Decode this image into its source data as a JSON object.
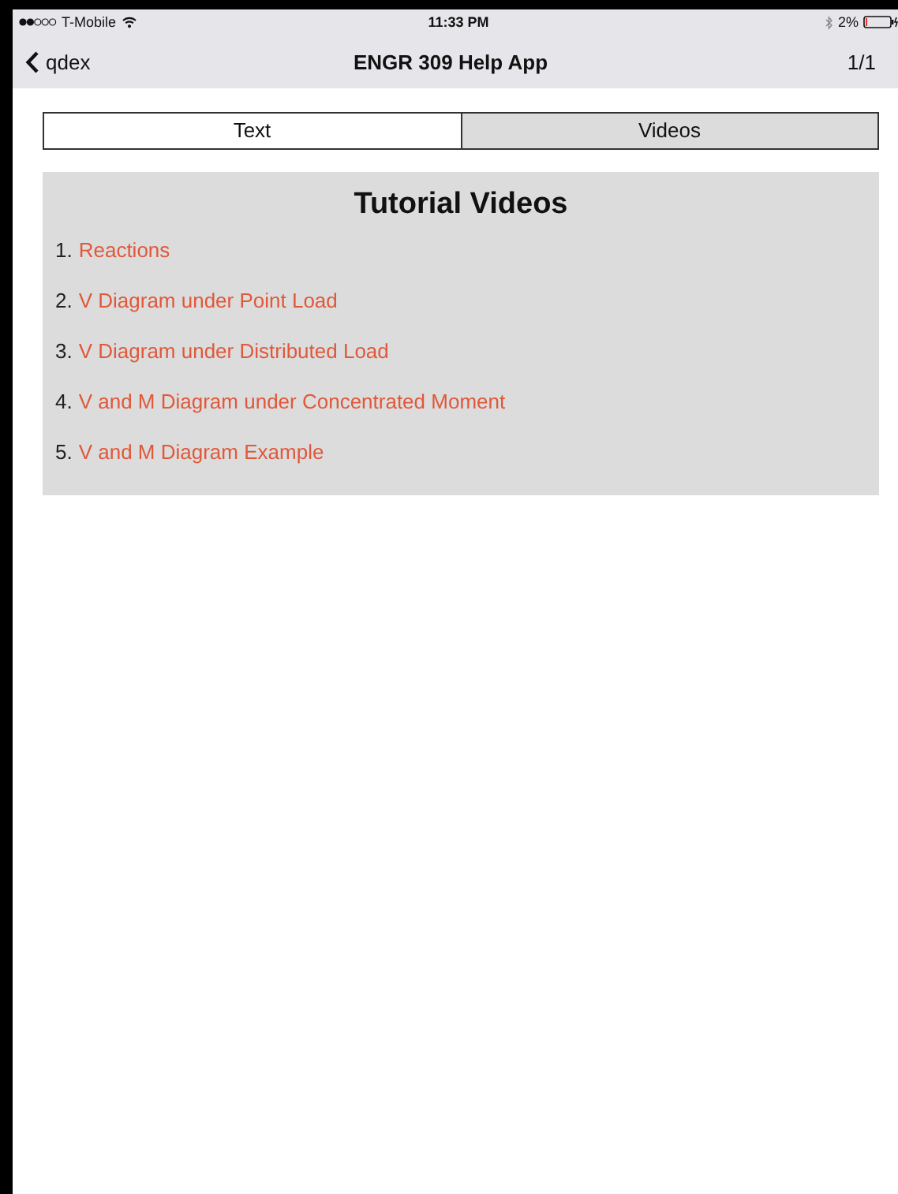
{
  "status_bar": {
    "carrier": "T-Mobile",
    "time": "11:33 PM",
    "battery": "2%"
  },
  "nav_bar": {
    "back": "qdex",
    "title": "ENGR 309 Help App",
    "page": "1/1"
  },
  "tabs": [
    {
      "label": "Text",
      "selected": false
    },
    {
      "label": "Videos",
      "selected": true
    }
  ],
  "panel": {
    "title": "Tutorial Videos",
    "items": [
      {
        "number": "1.",
        "link": "Reactions"
      },
      {
        "number": "2.",
        "link": "V Diagram under Point Load"
      },
      {
        "number": "3.",
        "link": "V Diagram under Distributed Load"
      },
      {
        "number": "4.",
        "link": "V and M Diagram under Concentrated Moment"
      },
      {
        "number": "5.",
        "link": "V and M Diagram Example"
      }
    ]
  }
}
